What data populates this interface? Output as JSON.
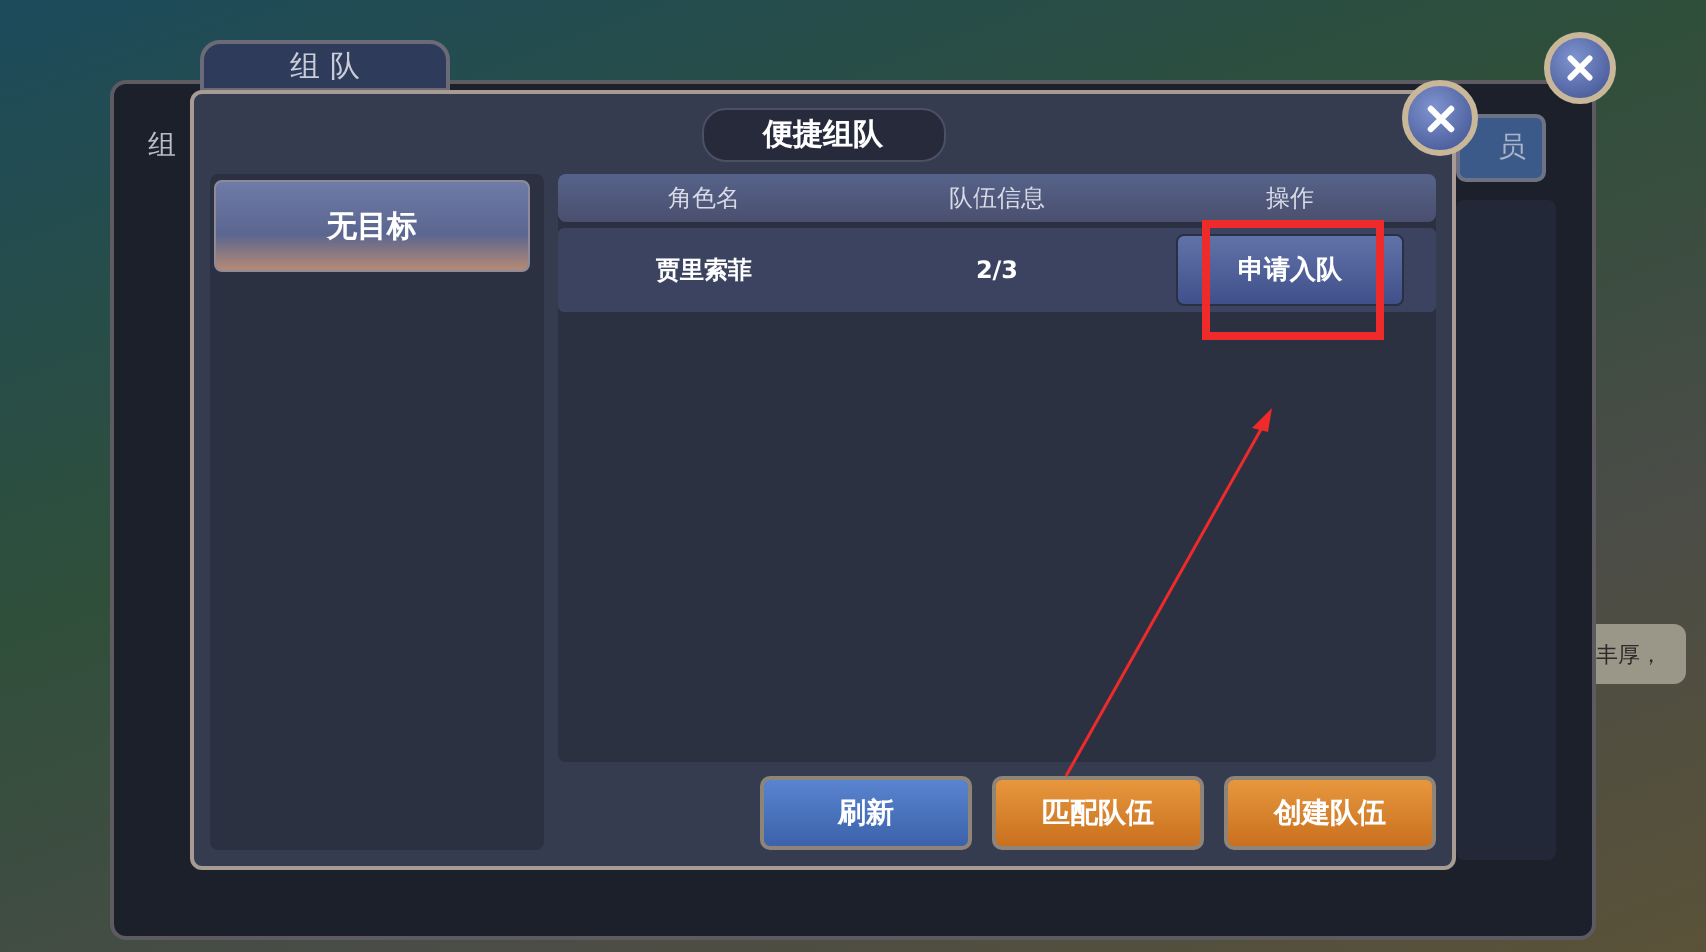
{
  "background_window": {
    "tab": "组 队",
    "label": "组",
    "button": "员",
    "toast": "丰厚，"
  },
  "dialog": {
    "title": "便捷组队",
    "filters": [
      {
        "label": "无目标",
        "selected": true
      }
    ],
    "table": {
      "columns": [
        "角色名",
        "队伍信息",
        "操作"
      ],
      "rows": [
        {
          "name": "贾里索菲",
          "team": "2/3",
          "action": "申请入队"
        }
      ]
    },
    "buttons": [
      {
        "label": "刷新",
        "kind": "secondary"
      },
      {
        "label": "匹配队伍",
        "kind": "primary"
      },
      {
        "label": "创建队伍",
        "kind": "primary"
      }
    ]
  }
}
